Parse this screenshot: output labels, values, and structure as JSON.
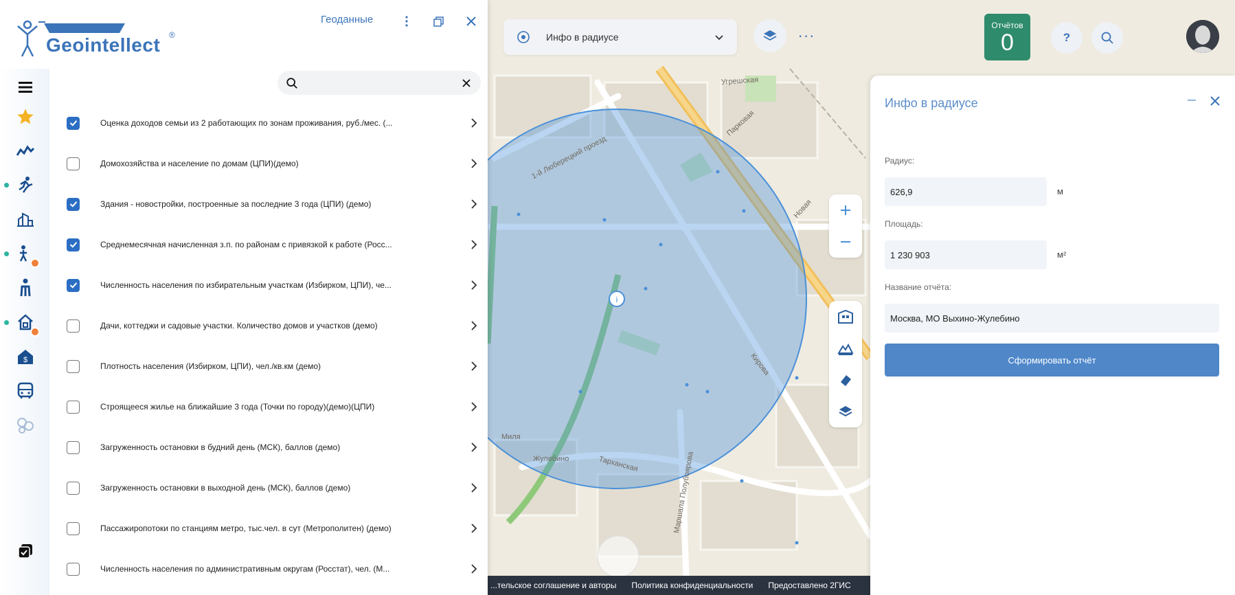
{
  "app": {
    "logo_text": "Geointellect",
    "logo_reg": "®"
  },
  "left_panel": {
    "top_link": "Геоданные",
    "search": {
      "value": "",
      "placeholder": ""
    },
    "layers": [
      {
        "label": "Оценка доходов семьи из 2 работающих по зонам проживания, руб./мес. (...",
        "checked": true
      },
      {
        "label": "Домохозяйства и население по домам (ЦПИ)(демо)",
        "checked": false
      },
      {
        "label": "Здания - новостройки, построенные за последние 3 года (ЦПИ) (демо)",
        "checked": true
      },
      {
        "label": "Среднемесячная начисленная з.п. по районам с привязкой к работе (Росс...",
        "checked": true
      },
      {
        "label": "Численность населения по избирательным участкам (Избирком, ЦПИ), че...",
        "checked": true
      },
      {
        "label": "Дачи, коттеджи и садовые участки. Количество домов и участков (демо)",
        "checked": false
      },
      {
        "label": "Плотность населения (Избирком, ЦПИ), чел./кв.км (демо)",
        "checked": false
      },
      {
        "label": "Строящееся жилье на ближайшие 3 года (Точки по городу)(демо)(ЦПИ)",
        "checked": false
      },
      {
        "label": "Загруженность остановки в будний день (МСК), баллов (демо)",
        "checked": false
      },
      {
        "label": "Загруженность остановки в выходной день (МСК), баллов (демо)",
        "checked": false
      },
      {
        "label": "Пассажиропотоки по станциям метро, тыс.чел. в сут (Метрополитен) (демо)",
        "checked": false
      },
      {
        "label": "Численность населения по административным округам (Росстат), чел. (М...",
        "checked": false
      }
    ]
  },
  "topbar": {
    "mode_select": "Инфо в радиусе",
    "reports_label": "Отчётов",
    "reports_count": "0"
  },
  "map": {
    "streets": [
      "1-й Люберецкий проезд",
      "Парковая",
      "Новая",
      "Кирова",
      "Тарханская",
      "Маршала Полубоярова",
      "Жулебино",
      "Миля",
      "Угрешская"
    ],
    "footer": [
      "...тельское соглашение и авторы",
      "Политика конфиденциальности",
      "Предоставлено 2ГИС"
    ]
  },
  "right_panel": {
    "title": "Инфо в радиусе",
    "radius_label": "Радиус:",
    "radius_value": "626,9",
    "radius_unit": "м",
    "area_label": "Площадь:",
    "area_value": "1 230 903",
    "area_unit": "м²",
    "report_name_label": "Название отчёта:",
    "report_name_value": "Москва, МО Выхино-Жулебино",
    "submit_label": "Сформировать отчёт"
  },
  "colors": {
    "brand": "#3b74b9",
    "checkbox_on": "#2b6ec4",
    "reports_badge": "#2e8b6c",
    "radius_circle": "#4a90d9",
    "badge_orange": "#f0813a",
    "dot_teal": "#2bb5a1"
  }
}
